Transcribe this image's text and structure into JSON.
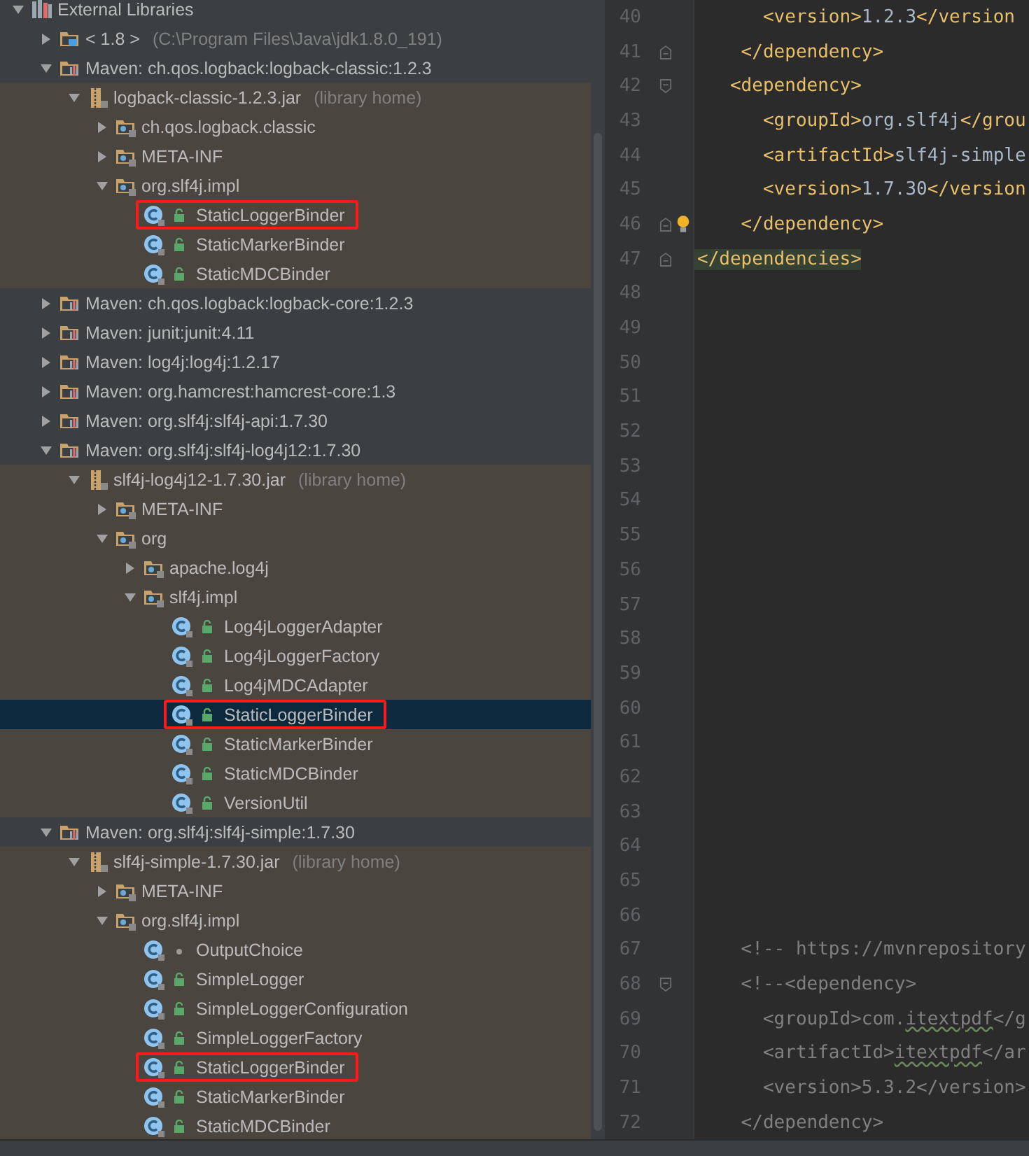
{
  "tree": [
    {
      "label": "External Libraries",
      "kind": "root",
      "expanded": true,
      "selected": false,
      "marked": false,
      "children": [
        {
          "label": "< 1.8 >",
          "suffix": "(C:\\Program Files\\Java\\jdk1.8.0_191)",
          "kind": "jdk",
          "expanded": false,
          "selected": false,
          "marked": false
        },
        {
          "label": "Maven: ch.qos.logback:logback-classic:1.2.3",
          "kind": "maven",
          "expanded": true,
          "selected": false,
          "marked": false,
          "children": [
            {
              "label": "logback-classic-1.2.3.jar",
              "suffix": "(library home)",
              "kind": "jar",
              "expanded": true,
              "selected": false,
              "marked": false,
              "children": [
                {
                  "label": "ch.qos.logback.classic",
                  "kind": "package",
                  "expanded": false,
                  "selected": false,
                  "marked": false
                },
                {
                  "label": "META-INF",
                  "kind": "package",
                  "expanded": false,
                  "selected": false,
                  "marked": false
                },
                {
                  "label": "org.slf4j.impl",
                  "kind": "package",
                  "expanded": true,
                  "selected": false,
                  "marked": false,
                  "children": [
                    {
                      "label": "StaticLoggerBinder",
                      "kind": "class",
                      "public": true,
                      "selected": false,
                      "marked": true
                    },
                    {
                      "label": "StaticMarkerBinder",
                      "kind": "class",
                      "public": true,
                      "selected": false,
                      "marked": false
                    },
                    {
                      "label": "StaticMDCBinder",
                      "kind": "class",
                      "public": true,
                      "selected": false,
                      "marked": false
                    }
                  ]
                }
              ]
            }
          ]
        },
        {
          "label": "Maven: ch.qos.logback:logback-core:1.2.3",
          "kind": "maven",
          "expanded": false,
          "selected": false,
          "marked": false
        },
        {
          "label": "Maven: junit:junit:4.11",
          "kind": "maven",
          "expanded": false,
          "selected": false,
          "marked": false
        },
        {
          "label": "Maven: log4j:log4j:1.2.17",
          "kind": "maven",
          "expanded": false,
          "selected": false,
          "marked": false
        },
        {
          "label": "Maven: org.hamcrest:hamcrest-core:1.3",
          "kind": "maven",
          "expanded": false,
          "selected": false,
          "marked": false
        },
        {
          "label": "Maven: org.slf4j:slf4j-api:1.7.30",
          "kind": "maven",
          "expanded": false,
          "selected": false,
          "marked": false
        },
        {
          "label": "Maven: org.slf4j:slf4j-log4j12:1.7.30",
          "kind": "maven",
          "expanded": true,
          "selected": false,
          "marked": false,
          "children": [
            {
              "label": "slf4j-log4j12-1.7.30.jar",
              "suffix": "(library home)",
              "kind": "jar",
              "expanded": true,
              "selected": false,
              "marked": false,
              "children": [
                {
                  "label": "META-INF",
                  "kind": "package",
                  "expanded": false,
                  "selected": false,
                  "marked": false
                },
                {
                  "label": "org",
                  "kind": "package",
                  "expanded": true,
                  "selected": false,
                  "marked": false,
                  "children": [
                    {
                      "label": "apache.log4j",
                      "kind": "package",
                      "expanded": false,
                      "selected": false,
                      "marked": false
                    },
                    {
                      "label": "slf4j.impl",
                      "kind": "package",
                      "expanded": true,
                      "selected": false,
                      "marked": false,
                      "children": [
                        {
                          "label": "Log4jLoggerAdapter",
                          "kind": "class",
                          "public": true,
                          "selected": false,
                          "marked": false
                        },
                        {
                          "label": "Log4jLoggerFactory",
                          "kind": "class",
                          "public": true,
                          "selected": false,
                          "marked": false
                        },
                        {
                          "label": "Log4jMDCAdapter",
                          "kind": "class",
                          "public": true,
                          "selected": false,
                          "marked": false
                        },
                        {
                          "label": "StaticLoggerBinder",
                          "kind": "class",
                          "public": true,
                          "selected": true,
                          "marked": true
                        },
                        {
                          "label": "StaticMarkerBinder",
                          "kind": "class",
                          "public": true,
                          "selected": false,
                          "marked": false
                        },
                        {
                          "label": "StaticMDCBinder",
                          "kind": "class",
                          "public": true,
                          "selected": false,
                          "marked": false
                        },
                        {
                          "label": "VersionUtil",
                          "kind": "class",
                          "public": true,
                          "selected": false,
                          "marked": false
                        }
                      ]
                    }
                  ]
                }
              ]
            }
          ]
        },
        {
          "label": "Maven: org.slf4j:slf4j-simple:1.7.30",
          "kind": "maven",
          "expanded": true,
          "selected": false,
          "marked": false,
          "children": [
            {
              "label": "slf4j-simple-1.7.30.jar",
              "suffix": "(library home)",
              "kind": "jar",
              "expanded": true,
              "selected": false,
              "marked": false,
              "children": [
                {
                  "label": "META-INF",
                  "kind": "package",
                  "expanded": false,
                  "selected": false,
                  "marked": false
                },
                {
                  "label": "org.slf4j.impl",
                  "kind": "package",
                  "expanded": true,
                  "selected": false,
                  "marked": false,
                  "children": [
                    {
                      "label": "OutputChoice",
                      "kind": "class",
                      "public": false,
                      "selected": false,
                      "marked": false
                    },
                    {
                      "label": "SimpleLogger",
                      "kind": "class",
                      "public": true,
                      "selected": false,
                      "marked": false
                    },
                    {
                      "label": "SimpleLoggerConfiguration",
                      "kind": "class",
                      "public": true,
                      "selected": false,
                      "marked": false
                    },
                    {
                      "label": "SimpleLoggerFactory",
                      "kind": "class",
                      "public": true,
                      "selected": false,
                      "marked": false
                    },
                    {
                      "label": "StaticLoggerBinder",
                      "kind": "class",
                      "public": true,
                      "selected": false,
                      "marked": true
                    },
                    {
                      "label": "StaticMarkerBinder",
                      "kind": "class",
                      "public": true,
                      "selected": false,
                      "marked": false
                    },
                    {
                      "label": "StaticMDCBinder",
                      "kind": "class",
                      "public": true,
                      "selected": false,
                      "marked": false
                    }
                  ]
                }
              ]
            }
          ]
        }
      ]
    }
  ],
  "editor": {
    "lines": [
      {
        "number": "40",
        "segments": [
          {
            "text": "      <version>",
            "kind": "tag"
          },
          {
            "text": "1.2.3",
            "kind": "text"
          },
          {
            "text": "</version",
            "kind": "tag"
          }
        ]
      },
      {
        "number": "41",
        "fold_end": true,
        "segments": [
          {
            "text": "    </dependency>",
            "kind": "tag"
          }
        ]
      },
      {
        "number": "42",
        "fold_start": true,
        "segments": [
          {
            "text": "   <dependency>",
            "kind": "tag"
          }
        ]
      },
      {
        "number": "43",
        "segments": [
          {
            "text": "      <groupId>",
            "kind": "tag"
          },
          {
            "text": "org.slf4j",
            "kind": "text"
          },
          {
            "text": "</grou",
            "kind": "tag"
          }
        ]
      },
      {
        "number": "44",
        "segments": [
          {
            "text": "      <artifactId>",
            "kind": "tag"
          },
          {
            "text": "slf4j-simple",
            "kind": "text"
          }
        ]
      },
      {
        "number": "45",
        "segments": [
          {
            "text": "      <version>",
            "kind": "tag"
          },
          {
            "text": "1.7.30",
            "kind": "text"
          },
          {
            "text": "</version",
            "kind": "tag"
          }
        ]
      },
      {
        "number": "46",
        "fold_end": true,
        "intention": true,
        "segments": [
          {
            "text": "    </dependency>",
            "kind": "tag"
          }
        ]
      },
      {
        "number": "47",
        "fold_end": true,
        "highlighted": true,
        "segments": [
          {
            "text": "</dependencies>",
            "kind": "tag"
          }
        ]
      },
      {
        "number": "48"
      },
      {
        "number": "49"
      },
      {
        "number": "50"
      },
      {
        "number": "51"
      },
      {
        "number": "52"
      },
      {
        "number": "53"
      },
      {
        "number": "54"
      },
      {
        "number": "55"
      },
      {
        "number": "56"
      },
      {
        "number": "57"
      },
      {
        "number": "58"
      },
      {
        "number": "59"
      },
      {
        "number": "60"
      },
      {
        "number": "61"
      },
      {
        "number": "62"
      },
      {
        "number": "63"
      },
      {
        "number": "64"
      },
      {
        "number": "65"
      },
      {
        "number": "66"
      },
      {
        "number": "67",
        "segments": [
          {
            "text": "    <!-- https://mvnrepository",
            "kind": "comment"
          }
        ]
      },
      {
        "number": "68",
        "fold_start": true,
        "segments": [
          {
            "text": "    <!--<dependency>",
            "kind": "comment"
          }
        ]
      },
      {
        "number": "69",
        "segments": [
          {
            "text": "      <groupId>com.",
            "kind": "comment"
          },
          {
            "text": "itextpdf",
            "kind": "typo"
          },
          {
            "text": "</g",
            "kind": "comment"
          }
        ]
      },
      {
        "number": "70",
        "segments": [
          {
            "text": "      <artifactId>",
            "kind": "comment"
          },
          {
            "text": "itextpdf",
            "kind": "typo"
          },
          {
            "text": "</ar",
            "kind": "comment"
          }
        ]
      },
      {
        "number": "71",
        "segments": [
          {
            "text": "      <version>5.3.2</version>",
            "kind": "comment"
          }
        ]
      },
      {
        "number": "72",
        "segments": [
          {
            "text": "    </dependency>",
            "kind": "comment"
          }
        ]
      }
    ]
  }
}
